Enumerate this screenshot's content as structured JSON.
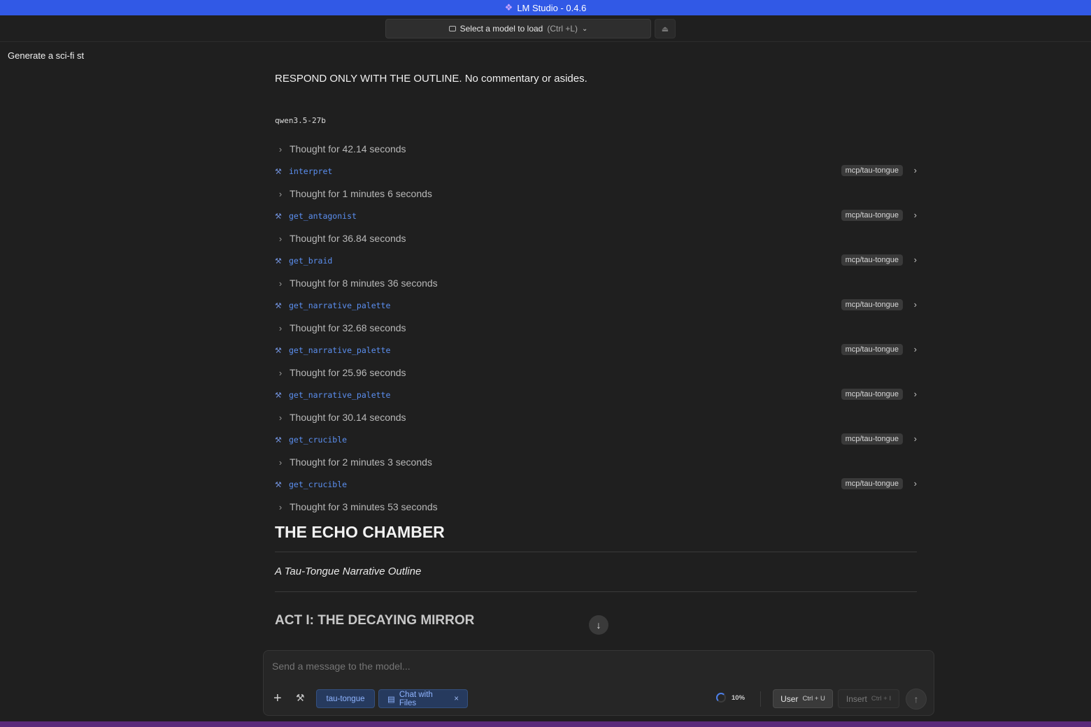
{
  "app": {
    "title": "LM Studio - 0.4.6",
    "logo_icon": "lm-studio-logo"
  },
  "topbar": {
    "model_select_label": "Select a model to load",
    "model_select_shortcut": "(Ctrl +L)",
    "eject_icon": "eject-icon"
  },
  "sidebar": {
    "chat_title": "Generate a sci-fi st"
  },
  "conversation": {
    "prompt_text": "RESPOND ONLY WITH THE OUTLINE. No commentary or asides.",
    "model_name": "qwen3.5-27b",
    "steps": [
      {
        "kind": "thought",
        "label": "Thought for 42.14 seconds"
      },
      {
        "kind": "tool",
        "name": "interpret",
        "source": "mcp/tau-tongue"
      },
      {
        "kind": "thought",
        "label": "Thought for 1 minutes 6 seconds"
      },
      {
        "kind": "tool",
        "name": "get_antagonist",
        "source": "mcp/tau-tongue"
      },
      {
        "kind": "thought",
        "label": "Thought for 36.84 seconds"
      },
      {
        "kind": "tool",
        "name": "get_braid",
        "source": "mcp/tau-tongue"
      },
      {
        "kind": "thought",
        "label": "Thought for 8 minutes 36 seconds"
      },
      {
        "kind": "tool",
        "name": "get_narrative_palette",
        "source": "mcp/tau-tongue"
      },
      {
        "kind": "thought",
        "label": "Thought for 32.68 seconds"
      },
      {
        "kind": "tool",
        "name": "get_narrative_palette",
        "source": "mcp/tau-tongue"
      },
      {
        "kind": "thought",
        "label": "Thought for 25.96 seconds"
      },
      {
        "kind": "tool",
        "name": "get_narrative_palette",
        "source": "mcp/tau-tongue"
      },
      {
        "kind": "thought",
        "label": "Thought for 30.14 seconds"
      },
      {
        "kind": "tool",
        "name": "get_crucible",
        "source": "mcp/tau-tongue"
      },
      {
        "kind": "thought",
        "label": "Thought for 2 minutes 3 seconds"
      },
      {
        "kind": "tool",
        "name": "get_crucible",
        "source": "mcp/tau-tongue"
      },
      {
        "kind": "thought",
        "label": "Thought for 3 minutes 53 seconds"
      }
    ],
    "doc_title": "THE ECHO CHAMBER",
    "doc_subtitle": "A Tau-Tongue Narrative Outline",
    "act_heading": "ACT I: THE DECAYING MIRROR"
  },
  "composer": {
    "placeholder": "Send a message to the model...",
    "chips": {
      "tau": "tau-tongue",
      "files": "Chat with Files"
    },
    "context_percent": "10%",
    "user_label": "User",
    "user_shortcut": "Ctrl + U",
    "insert_label": "Insert",
    "insert_shortcut": "Ctrl + I"
  },
  "colors": {
    "titlebar": "#3159e6",
    "tool_link": "#5b8ff0",
    "background": "#1f1f1f"
  }
}
